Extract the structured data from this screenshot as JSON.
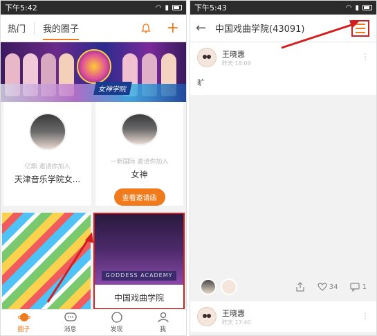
{
  "left": {
    "status_time": "下午5:42",
    "tabs": [
      "热门",
      "我的圈子"
    ],
    "banner_label": "女神学院",
    "cards": [
      {
        "hint": "亿鼎 邀请你加入",
        "title": "天津音乐学院女..."
      },
      {
        "hint": "一新国际 邀请你加入",
        "title": "女神",
        "button": "查看邀请函"
      }
    ],
    "tile_caption": "GODDESS ACADEMY",
    "tile_name": "中国戏曲学院",
    "tabbar": [
      "圈子",
      "消息",
      "发现",
      "我"
    ]
  },
  "right": {
    "status_time": "下午5:43",
    "title": "中国戏曲学院(43091)",
    "post": {
      "name": "王晓惠",
      "time": "昨天 18:09",
      "body": "旷"
    },
    "likes": "34",
    "comments": "1",
    "post2": {
      "name": "王晓惠",
      "time": "昨天 17:40"
    }
  },
  "colors": {
    "accent": "#f07b1c",
    "highlight": "#d11f1f"
  },
  "icons": [
    "bell-icon",
    "plus-icon",
    "back-arrow-icon",
    "menu-icon",
    "share-icon",
    "heart-icon",
    "comment-icon"
  ]
}
